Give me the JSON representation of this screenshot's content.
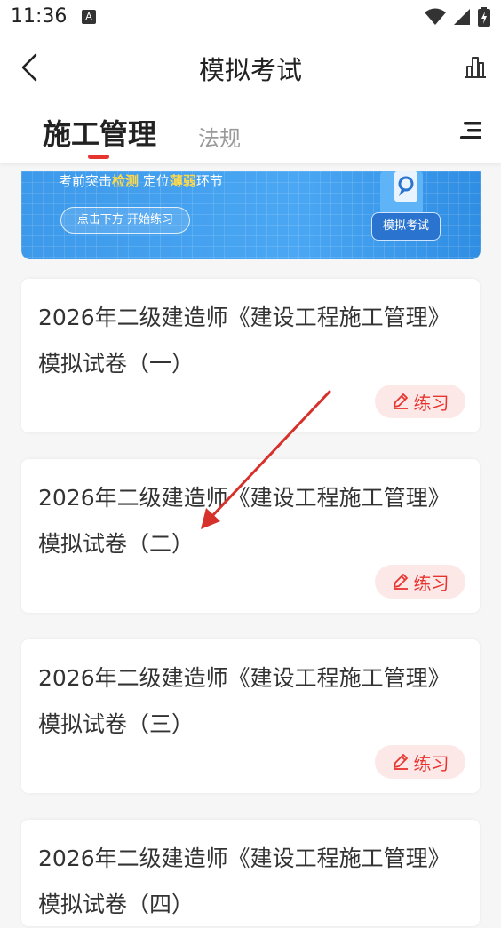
{
  "status": {
    "time": "11:36",
    "notification_glyph": "A"
  },
  "nav": {
    "title": "模拟考试"
  },
  "tabs": [
    {
      "label": "施工管理",
      "active": true
    },
    {
      "label": "法规",
      "active": false
    }
  ],
  "banner": {
    "line_pre": "考前突击",
    "line_hl1": "检测",
    "line_mid": "定位",
    "line_hl2": "薄弱",
    "line_post": "环节",
    "button_text": "点击下方 开始练习",
    "tag": "模拟考试"
  },
  "cards": [
    {
      "title": "2026年二级建造师《建设工程施工管理》模拟试卷（一）",
      "action": "练习"
    },
    {
      "title": "2026年二级建造师《建设工程施工管理》模拟试卷（二）",
      "action": "练习"
    },
    {
      "title": "2026年二级建造师《建设工程施工管理》模拟试卷（三）",
      "action": "练习"
    },
    {
      "title": "2026年二级建造师《建设工程施工管理》模拟试卷（四）",
      "action": ""
    }
  ],
  "colors": {
    "accent": "#e7342f",
    "accent_bg": "#fde8e8",
    "banner_blue": "#4aa7f3",
    "annotation_arrow": "#d6312b"
  }
}
